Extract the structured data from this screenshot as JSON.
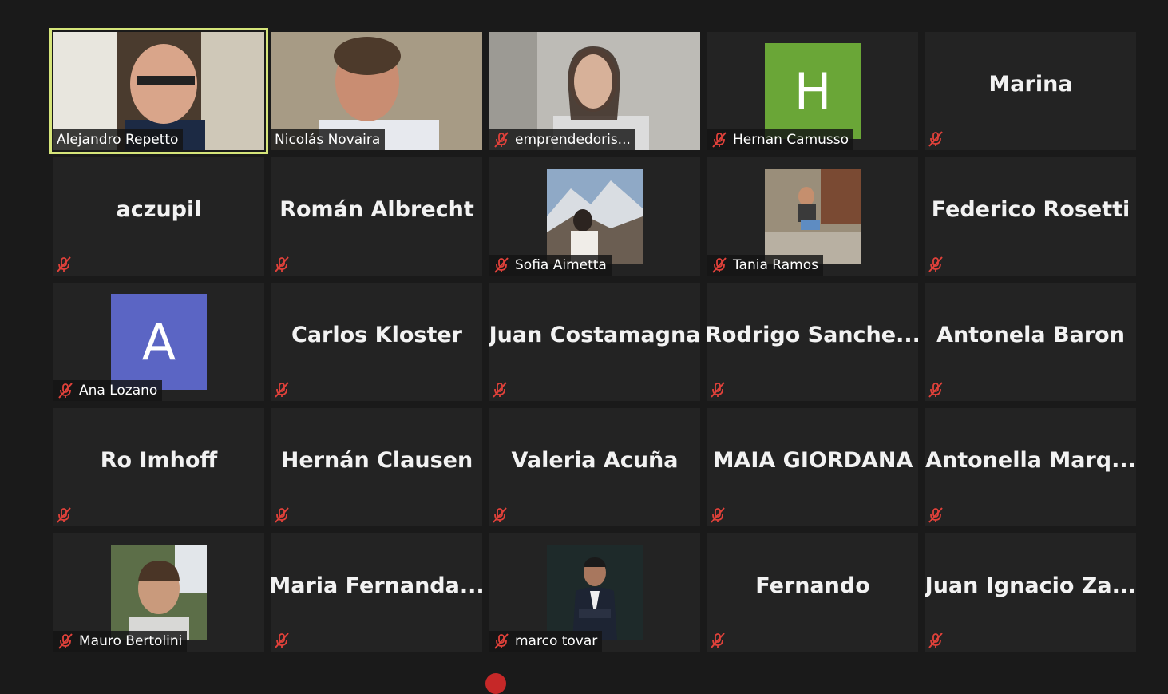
{
  "participants": [
    {
      "name": "Alejandro Repetto",
      "type": "video",
      "muted": false,
      "active": true
    },
    {
      "name": "Nicolás Novaira",
      "type": "video",
      "muted": false
    },
    {
      "name": "emprendedoris...",
      "type": "video",
      "muted": true
    },
    {
      "name": "Hernan Camusso",
      "type": "avatar",
      "initial": "H",
      "avatar_color": "#6aa637",
      "muted": true
    },
    {
      "name": "Marina",
      "type": "name",
      "muted": true
    },
    {
      "name": "aczupil",
      "type": "name",
      "muted": true
    },
    {
      "name": "Román Albrecht",
      "type": "name",
      "muted": true
    },
    {
      "name": "Sofia Aimetta",
      "type": "photo",
      "muted": true
    },
    {
      "name": "Tania Ramos",
      "type": "photo",
      "muted": true
    },
    {
      "name": "Federico Rosetti",
      "type": "name",
      "muted": true
    },
    {
      "name": "Ana Lozano",
      "type": "avatar",
      "initial": "A",
      "avatar_color": "#5b65c4",
      "muted": true
    },
    {
      "name": "Carlos Kloster",
      "type": "name",
      "muted": true
    },
    {
      "name": "Juan Costamagna",
      "type": "name",
      "muted": true
    },
    {
      "name": "Rodrigo  Sanche...",
      "type": "name",
      "muted": true
    },
    {
      "name": "Antonela Baron",
      "type": "name",
      "muted": true
    },
    {
      "name": "Ro Imhoff",
      "type": "name",
      "muted": true
    },
    {
      "name": "Hernán Clausen",
      "type": "name",
      "muted": true
    },
    {
      "name": "Valeria Acuña",
      "type": "name",
      "muted": true
    },
    {
      "name": "MAIA GIORDANA",
      "type": "name",
      "muted": true
    },
    {
      "name": "Antonella  Marq...",
      "type": "name",
      "muted": true
    },
    {
      "name": "Mauro Bertolini",
      "type": "photo",
      "muted": true
    },
    {
      "name": "Maria  Fernanda...",
      "type": "name",
      "muted": true
    },
    {
      "name": "marco tovar",
      "type": "photo",
      "muted": true
    },
    {
      "name": "Fernando",
      "type": "name",
      "muted": true
    },
    {
      "name": "Juan  Ignacio  Za...",
      "type": "name",
      "muted": true
    }
  ],
  "icons": {
    "mute": "mic-muted-icon"
  },
  "colors": {
    "background": "#1a1a1a",
    "tile": "#232323",
    "active_border": "#d6e57a",
    "mute_red": "#e0413a"
  }
}
